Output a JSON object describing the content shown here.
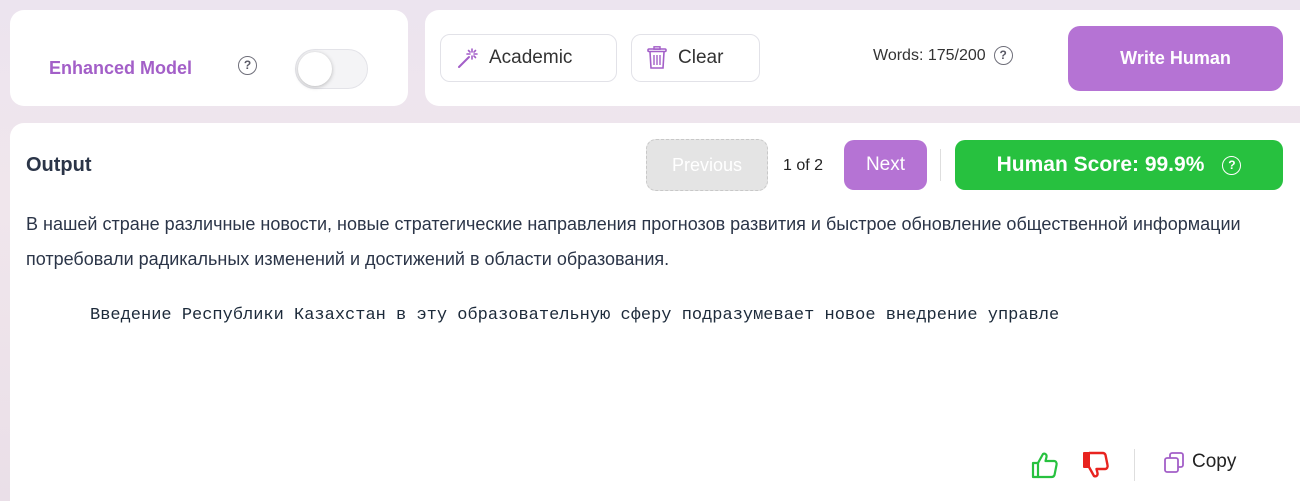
{
  "model": {
    "label": "Enhanced Model",
    "help_icon": "?",
    "toggle_on": false
  },
  "toolbar": {
    "academic_label": "Academic",
    "academic_icon": "magic-wand-icon",
    "clear_label": "Clear",
    "clear_icon": "trash-icon",
    "words_label": "Words: 175/200",
    "help_icon": "?",
    "write_label": "Write Human"
  },
  "output": {
    "title": "Output",
    "previous_label": "Previous",
    "page_info": "1 of 2",
    "next_label": "Next",
    "score_label": "Human Score: 99.9%",
    "help_icon": "?",
    "paragraph": "В нашей стране различные новости, новые стратегические направления прогнозов развития и быстрое обновление общественной информации потребовали радикальных изменений и достижений в области образования.",
    "code_line": "Введение Республики Казахстан в эту образовательную сферу подразумевает новое внедрение управле",
    "copy_label": "Copy"
  },
  "colors": {
    "accent": "#b573d4",
    "accent_text": "#a35fc8",
    "score_green": "#27c13f",
    "thumb_up": "#27c13f",
    "thumb_down": "#e8231f"
  }
}
